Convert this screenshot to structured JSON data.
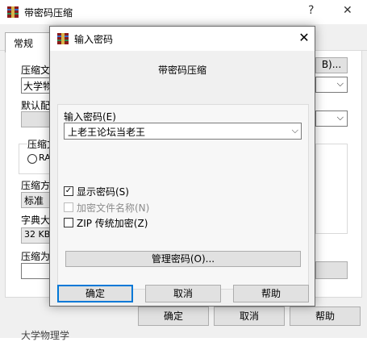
{
  "background_window": {
    "title": "带密码压缩",
    "help_button": "?",
    "close_button": "✕",
    "tab_general": "常规",
    "labels": {
      "archive_name": "压缩文",
      "default_config": "默认配",
      "archive_format": "压缩文",
      "compression_method": "压缩方",
      "dictionary_size": "字典大",
      "split_volumes": "压缩为"
    },
    "values": {
      "archive_name_value": "大学物",
      "browse_button_partial": "B)...",
      "radio_partial": "RA",
      "compression_method_value": "标准",
      "dictionary_size_value": "32 KB"
    },
    "buttons": {
      "ok": "确定",
      "cancel": "取消",
      "help": "帮助"
    },
    "bottom_partial_text": "大学物理学"
  },
  "dialog": {
    "title": "输入密码",
    "subtitle": "带密码压缩",
    "close_glyph": "✕",
    "password_label": "输入密码(E)",
    "password_value": "上老王论坛当老王",
    "checkboxes": [
      {
        "label": "显示密码(S)",
        "checked": true,
        "enabled": true
      },
      {
        "label": "加密文件名称(N)",
        "checked": false,
        "enabled": false
      },
      {
        "label": "ZIP 传统加密(Z)",
        "checked": false,
        "enabled": true
      }
    ],
    "manage_button": "管理密码(O)...",
    "buttons": {
      "ok": "确定",
      "cancel": "取消",
      "help": "帮助"
    }
  },
  "colors": {
    "winrar_red": "#8b1a1a",
    "accent_focus": "#0078d7"
  },
  "icons": {
    "app_icon": "winrar-archive-icon",
    "dropdown": "chevron-down-icon"
  }
}
